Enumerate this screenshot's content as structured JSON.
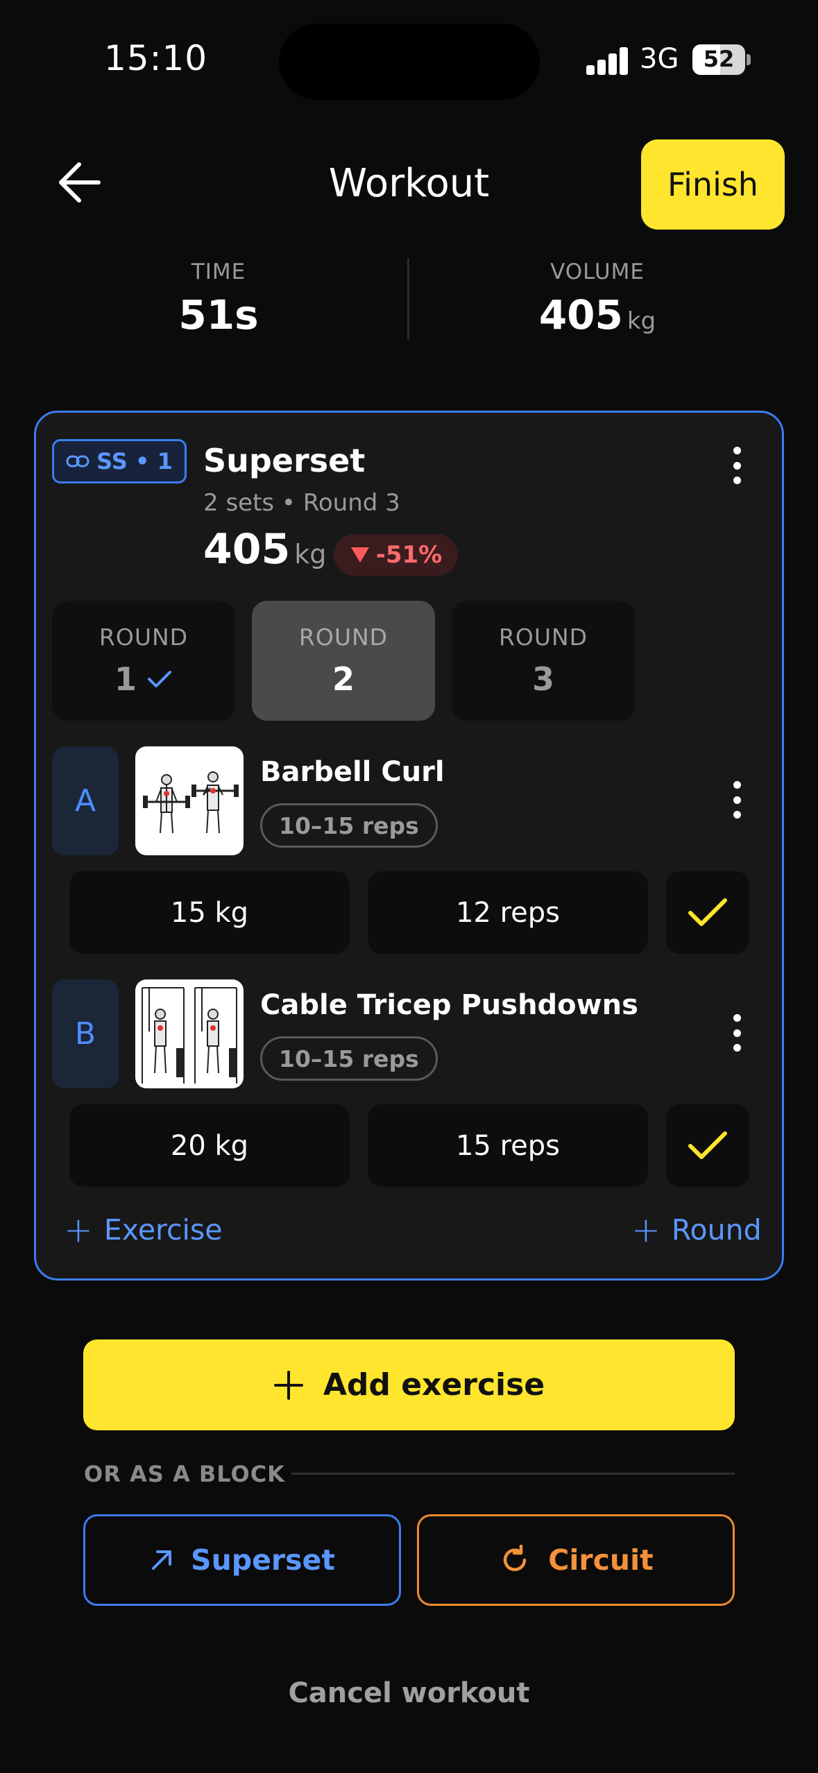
{
  "status_bar": {
    "time": "15:10",
    "network": "3G",
    "battery": "52"
  },
  "header": {
    "title": "Workout",
    "finish_label": "Finish",
    "back_icon": "arrow-left-icon"
  },
  "stats": {
    "time_label": "TIME",
    "time_value": "51s",
    "volume_label": "VOLUME",
    "volume_value": "405",
    "volume_unit": "kg"
  },
  "superset": {
    "badge": "SS • 1",
    "title": "Superset",
    "subtitle": "2 sets • Round 3",
    "volume": "405",
    "volume_unit": "kg",
    "delta": "-51%",
    "delta_color": "#ff6a6a",
    "rounds": [
      {
        "label": "ROUND",
        "number": "1",
        "done": true
      },
      {
        "label": "ROUND",
        "number": "2",
        "active": true
      },
      {
        "label": "ROUND",
        "number": "3"
      }
    ],
    "exercises": [
      {
        "letter": "A",
        "name": "Barbell Curl",
        "rep_range": "10–15 reps",
        "weight": "15 kg",
        "reps": "12 reps"
      },
      {
        "letter": "B",
        "name": "Cable Tricep Pushdowns",
        "rep_range": "10–15 reps",
        "weight": "20 kg",
        "reps": "15 reps"
      }
    ],
    "add_exercise_label": "Exercise",
    "add_round_label": "Round"
  },
  "actions": {
    "add_exercise": "Add exercise",
    "or_block_label": "OR AS A BLOCK",
    "superset_label": "Superset",
    "circuit_label": "Circuit",
    "cancel_label": "Cancel workout"
  },
  "colors": {
    "accent_yellow": "#ffe52e",
    "accent_blue": "#3b7df0",
    "accent_orange": "#f08a2e",
    "background": "#0b0b0b"
  }
}
